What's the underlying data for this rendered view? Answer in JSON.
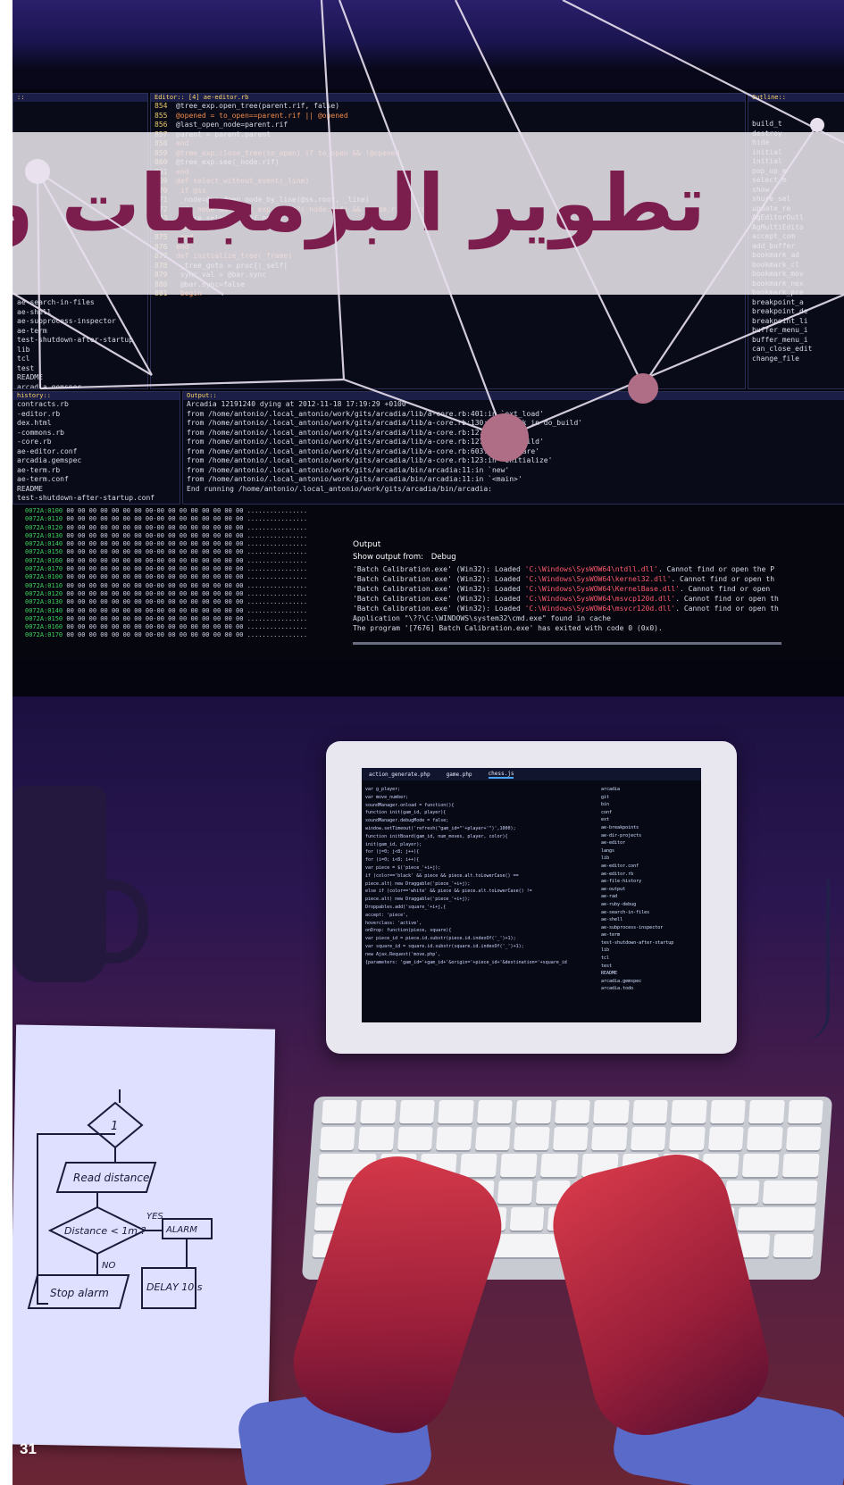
{
  "title": "تطوير البرمجيات و",
  "page_number": "31",
  "colors": {
    "title": "#7b1e4e",
    "band": "#eee9f0",
    "node": "#b06e86"
  },
  "editor": {
    "header": "Editor:: [4] ae-editor.rb",
    "lines": [
      {
        "n": "854",
        "t": "@tree_exp.open_tree(parent.rif, false)"
      },
      {
        "n": "855",
        "t": "@opened = to_open==parent.rif || @opened"
      },
      {
        "n": "856",
        "t": "@last_open_node=parent.rif"
      },
      {
        "n": "857",
        "t": "parent = parent.parent"
      },
      {
        "n": "858",
        "t": "end"
      },
      {
        "n": "859",
        "t": "@tree_exp.close_tree(to_open) if to_open && !@opened"
      },
      {
        "n": "860",
        "t": "@tree_exp.see(_node.rif)"
      },
      {
        "n": "861",
        "t": "end"
      },
      {
        "n": "869",
        "t": "def select_without_event(_line)"
      },
      {
        "n": "870",
        "t": "  if @ss"
      },
      {
        "n": "871",
        "t": "    _node=@ss.deep_node_by_line(@ss.root, _line)"
      },
      {
        "n": "872",
        "t": "    if _node && @tree_exp.exist?(_node.rif) && _node.rif!='root'"
      },
      {
        "n": "873",
        "t": "      shure_select_node(_node)"
      },
      {
        "n": "874",
        "t": "    end"
      },
      {
        "n": "875",
        "t": "  end"
      },
      {
        "n": "876",
        "t": "end"
      },
      {
        "n": "877",
        "t": "def initialize_tree(_frame)"
      },
      {
        "n": "878",
        "t": "  _tree_goto = proc{|_self|"
      },
      {
        "n": "879",
        "t": "    sync_val = @bar.sync"
      },
      {
        "n": "880",
        "t": "    @bar.sync=false"
      },
      {
        "n": "881",
        "t": "    begin"
      }
    ]
  },
  "files_pane": {
    "items": [
      "ae-search-in-files",
      "ae-shell",
      "ae-subprocess-inspector",
      "ae-term",
      "test-shutdown-after-startup",
      "lib",
      "tcl",
      "test",
      "README",
      "arcadia.gemspec",
      "arcadia.todo",
      "arcadia"
    ]
  },
  "history_pane": {
    "header": "history::",
    "items": [
      "contracts.rb",
      "-editor.rb",
      "dex.html",
      "-commons.rb",
      "-core.rb",
      "ae-editor.conf",
      "arcadia.gemspec",
      "ae-term.rb",
      "ae-term.conf",
      "README",
      "test-shutdown-after-startup.conf"
    ]
  },
  "output_pane": {
    "header": "Output::",
    "lines": [
      "Arcadia 12191240 dying at 2012-11-18 17:19:29 +0100",
      "   from /home/antonio/.local_antonio/work/gits/arcadia/lib/a-core.rb:401:in `ext_load'",
      "   from /home/antonio/.local_antonio/work/gits/arcadia/lib/a-core.rb:130:in `block in do_build'",
      "   from /home/antonio/.local_antonio/work/gits/arcadia/lib/a-core.rb:127:in `each'",
      "   from /home/antonio/.local_antonio/work/gits/arcadia/lib/a-core.rb:127:in `do_build'",
      "   from /home/antonio/.local_antonio/work/gits/arcadia/lib/a-core.rb:603:in `prepare'",
      "   from /home/antonio/.local_antonio/work/gits/arcadia/lib/a-core.rb:123:in `initialize'",
      "   from /home/antonio/.local_antonio/work/gits/arcadia/bin/arcadia:11:in `new'",
      "   from /home/antonio/.local_antonio/work/gits/arcadia/bin/arcadia:11:in `<main>'",
      "End running /home/antonio/.local_antonio/work/gits/arcadia/bin/arcadia:"
    ]
  },
  "outline_pane": {
    "header": "Outline::",
    "items": [
      "build_t",
      "destroy",
      "hide",
      "initial",
      "initial",
      "pop_up_m",
      "select_m",
      "show",
      "shure_sel",
      "update_re",
      "AgEditorOutl",
      "AgMultiEdito",
      "accept_com",
      "add_buffer",
      "bookmark_ad",
      "bookmark_cl",
      "bookmark_mov",
      "bookmark_nex",
      "bookmark_pre",
      "breakpoint_a",
      "breakpoint_de",
      "breakpoint_li",
      "buffer_menu_i",
      "buffer_menu_i",
      "can_close_edit",
      "change_file"
    ]
  },
  "hex_dump": {
    "addresses": [
      "0072A:0100",
      "0072A:0110",
      "0072A:0120",
      "0072A:0130",
      "0072A:0140",
      "0072A:0150",
      "0072A:0160",
      "0072A:0170",
      "0072A:0100",
      "0072A:0110",
      "0072A:0120",
      "0072A:0130",
      "0072A:0140",
      "0072A:0150",
      "0072A:0160",
      "0072A:0170"
    ],
    "bytes": "00 00 00 00 00 00 00 00-00 00 00 00 00 00 00 00",
    "ascii": "................"
  },
  "vs_output": {
    "header": "Output",
    "show_from_label": "Show output from:",
    "show_from_value": "Debug",
    "lines": [
      {
        "pre": "'Batch Calibration.exe' (Win32): Loaded ",
        "path": "'C:\\Windows\\SysWOW64\\ntdll.dll'",
        "post": ". Cannot find or open the P"
      },
      {
        "pre": "'Batch Calibration.exe' (Win32): Loaded ",
        "path": "'C:\\Windows\\SysWOW64\\kernel32.dll'",
        "post": ". Cannot find or open th"
      },
      {
        "pre": "'Batch Calibration.exe' (Win32): Loaded ",
        "path": "'C:\\Windows\\SysWOW64\\KernelBase.dll'",
        "post": ". Cannot find or open"
      },
      {
        "pre": "'Batch Calibration.exe' (Win32): Loaded ",
        "path": "'C:\\Windows\\SysWOW64\\msvcp120d.dll'",
        "post": ". Cannot find or open th"
      },
      {
        "pre": "'Batch Calibration.exe' (Win32): Loaded ",
        "path": "'C:\\Windows\\SysWOW64\\msvcr120d.dll'",
        "post": ". Cannot find or open th"
      },
      {
        "pre": "Application \"\\??\\C:\\WINDOWS\\system32\\cmd.exe\" found in cache",
        "path": "",
        "post": ""
      },
      {
        "pre": "The program '[7676] Batch Calibration.exe' has exited with code 0 (0x0).",
        "path": "",
        "post": ""
      }
    ]
  },
  "tablet": {
    "tabs": [
      "action_generate.php",
      "game.php",
      "chess.js"
    ],
    "active_tab": 2,
    "code": [
      "var g_player;",
      "var move_number;",
      "soundManager.onload = function(){",
      "function init(gam_id, player){",
      "  soundManager.debugMode = false;",
      "  window.setTimeout('refresh(\"gam_id=\"'+player+'\")',1000);",
      "function initBoard(gam_id, num_moves, player, color){",
      "  init(gam_id, player);",
      "  for (j=0; j<8; j++){",
      "    for (i=0; i<8; i++){",
      "      var piece = $('piece_'+i+j);",
      "      if (color=='black' && piece && piece.alt.toLowerCase() ==",
      "  piece.alt) new Draggable('piece_'+i+j);",
      "      else if (color=='white' && piece && piece.alt.toLowerCase() !=",
      "  piece.alt) new Draggable('piece_'+i+j);",
      "      Droppables.add('square_'+i+j,{",
      "        accept: 'piece',",
      "        hoverclass: 'active',",
      "        onDrop: function(piece, square){",
      "          var piece_id = piece.id.substr(piece.id.indexOf('_')+1);",
      "          var square_id = square.id.substr(square.id.indexOf('_')+1);",
      "          new Ajax.Request('move.php',",
      "  {parameters: 'gam_id='+gam_id+'&origin='+piece_id+'&destination='+square_id"
    ],
    "tree": [
      "arcadia",
      "git",
      "bin",
      "conf",
      "ext",
      "ae-breakpoints",
      "ae-dir-projects",
      "ae-editor",
      "langs",
      "lib",
      "ae-editor.conf",
      "ae-editor.rb",
      "ae-file-history",
      "ae-output",
      "ae-rad",
      "ae-ruby-debug",
      "ae-search-in-files",
      "ae-shell",
      "ae-subprocess-inspector",
      "ae-term",
      "test-shutdown-after-startup",
      "lib",
      "tcl",
      "test",
      "README",
      "arcadia.gemspec",
      "arcadia.todo"
    ]
  },
  "flowchart": {
    "start": "1",
    "read": "Read distance",
    "decision": "Distance < 1m ?",
    "yes": "YES",
    "no": "NO",
    "alarm": "ALARM",
    "stop": "Stop alarm",
    "delay": "DELAY 10 s"
  }
}
